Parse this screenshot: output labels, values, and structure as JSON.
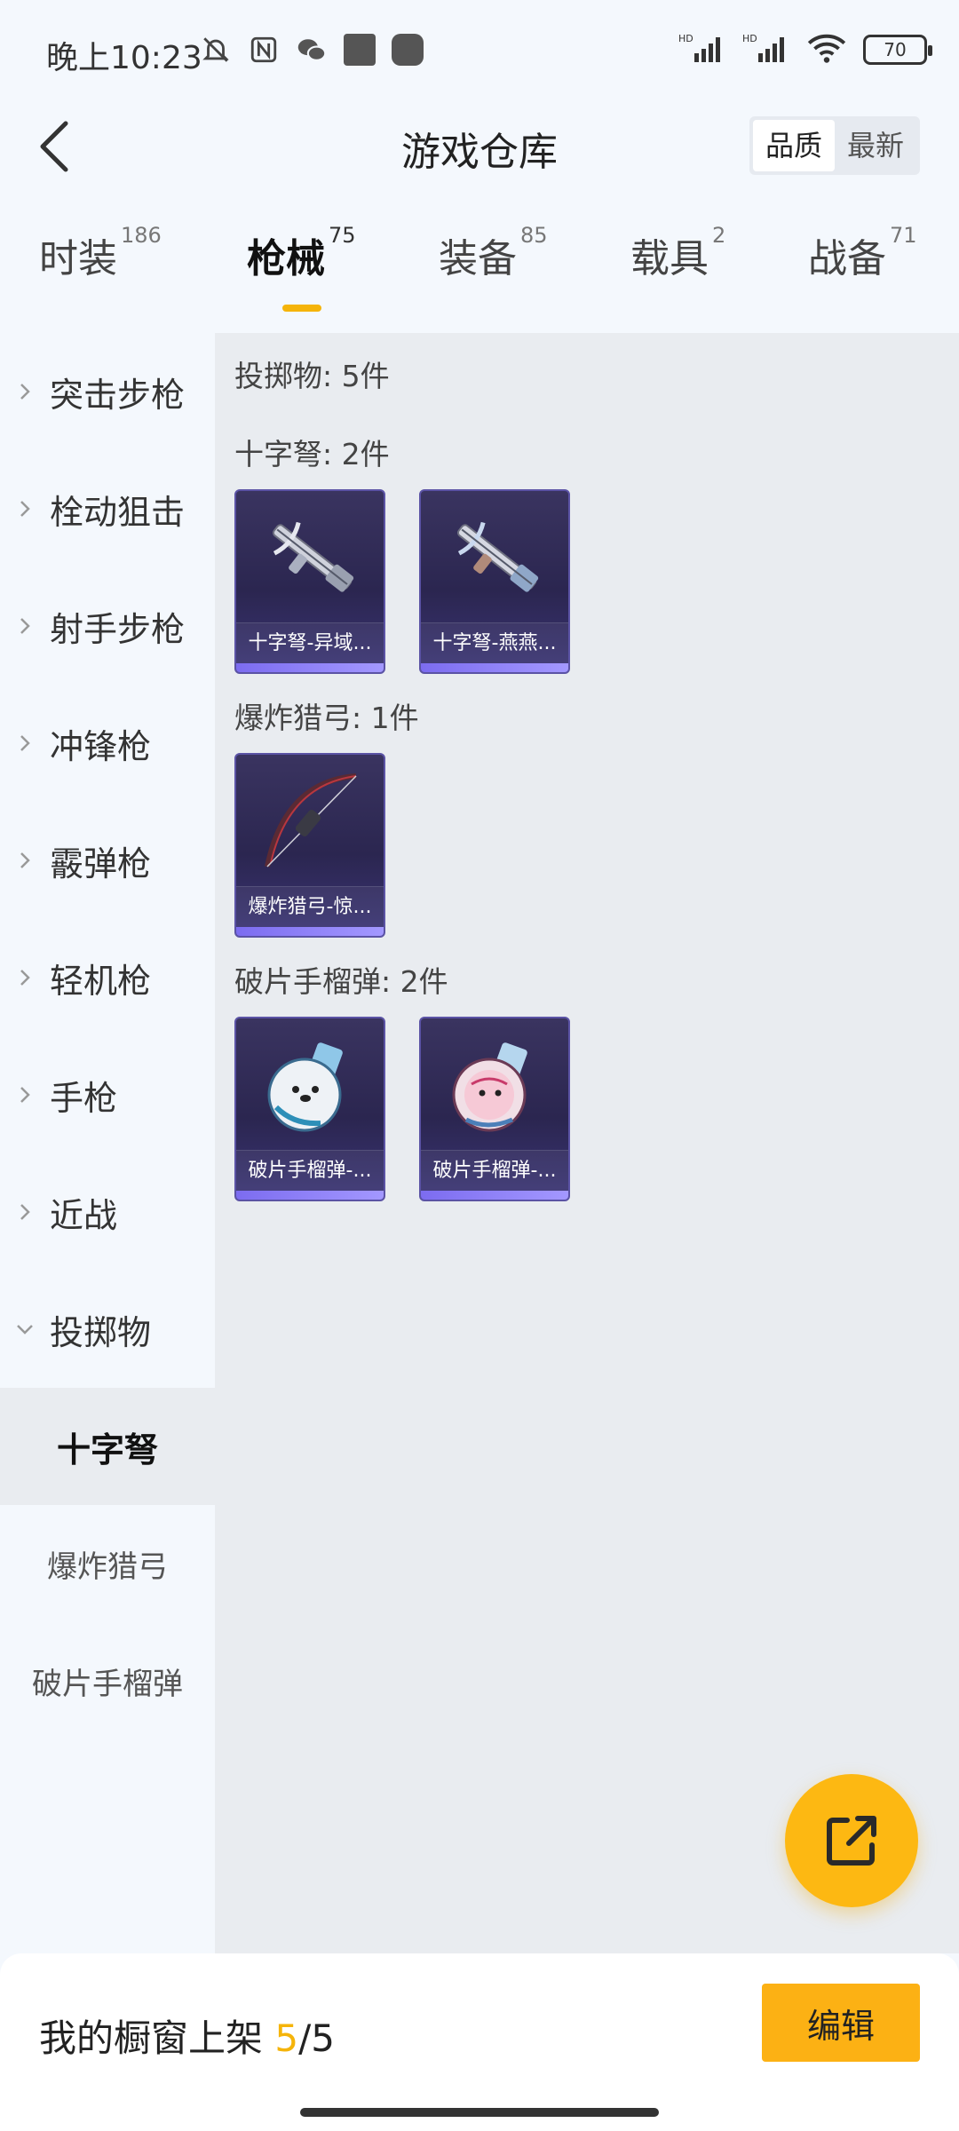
{
  "status_bar": {
    "time": "晚上10:23",
    "signal_label_1": "HD",
    "signal_label_2": "HD",
    "battery": "70"
  },
  "header": {
    "title": "游戏仓库",
    "sort_options": [
      "品质",
      "最新"
    ],
    "sort_selected": "品质"
  },
  "tabs": [
    {
      "label": "时装",
      "count": "186"
    },
    {
      "label": "枪械",
      "count": "75",
      "active": true
    },
    {
      "label": "装备",
      "count": "85"
    },
    {
      "label": "载具",
      "count": "2"
    },
    {
      "label": "战备",
      "count": "71"
    }
  ],
  "sidebar": {
    "items": [
      "突击步枪",
      "栓动狙击",
      "射手步枪",
      "冲锋枪",
      "霰弹枪",
      "轻机枪",
      "手枪",
      "近战",
      "投掷物"
    ],
    "subitems": [
      "十字弩",
      "爆炸猎弓",
      "破片手榴弹"
    ],
    "active_subitem": "十字弩"
  },
  "content": {
    "category_summary": "投掷物: 5件",
    "groups": [
      {
        "label": "十字弩: 2件",
        "items": [
          "十字弩-异域...",
          "十字弩-燕燕..."
        ]
      },
      {
        "label": "爆炸猎弓: 1件",
        "items": [
          "爆炸猎弓-惊..."
        ]
      },
      {
        "label": "破片手榴弹: 2件",
        "items": [
          "破片手榴弹-...",
          "破片手榴弹-..."
        ]
      }
    ]
  },
  "bottom": {
    "showcase_label": "我的橱窗上架",
    "showcase_current": "5",
    "showcase_sep": "/",
    "showcase_total": "5",
    "edit_label": "编辑"
  },
  "colors": {
    "accent": "#f5b40a",
    "card_bg": "#2b2650",
    "card_bar": "#7c6cf0"
  }
}
